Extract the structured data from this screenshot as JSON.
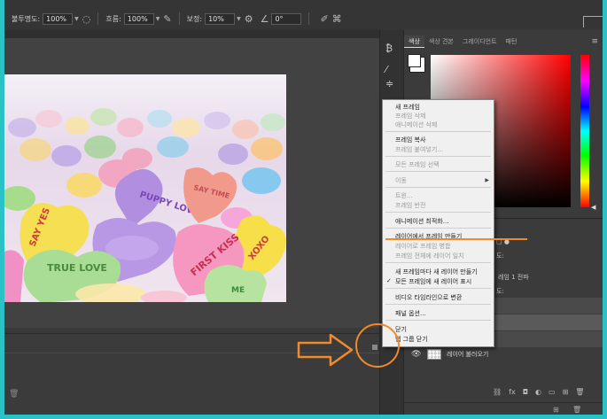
{
  "options_bar": {
    "opacity_label": "불투명도:",
    "opacity_value": "100%",
    "flow_label": "흐름:",
    "flow_value": "100%",
    "smoothing_label": "보정:",
    "smoothing_value": "10%",
    "angle_value": "0°"
  },
  "photo": {
    "hearts": [
      {
        "text": "SAY YES"
      },
      {
        "text": "TRUE LOVE"
      },
      {
        "text": "PUPPY LOVE"
      },
      {
        "text": "SAY TIME"
      },
      {
        "text": "FIRST KISS"
      },
      {
        "text": "XOXO"
      },
      {
        "text": "ME"
      }
    ]
  },
  "color_panel": {
    "tabs": [
      {
        "label": "색상"
      },
      {
        "label": "색상 견본"
      },
      {
        "label": "그레이디언트"
      },
      {
        "label": "패턴"
      }
    ]
  },
  "layers_fragments": {
    "frag_a": "도:",
    "frag_b": "레임 1 전파",
    "frag_c": "도:"
  },
  "layers": {
    "last_layer_name": "레이어 불러오기"
  },
  "context_menu": {
    "items": [
      {
        "label": "새 프레임",
        "disabled": false
      },
      {
        "label": "프레임 삭제",
        "disabled": true
      },
      {
        "label": "애니메이션 삭제",
        "disabled": true
      },
      {
        "label": "프레임 복사",
        "disabled": false
      },
      {
        "label": "프레임 붙여넣기...",
        "disabled": true
      },
      {
        "label": "모든 프레임 선택",
        "disabled": true
      },
      {
        "label": "이동",
        "disabled": true,
        "submenu": true
      },
      {
        "label": "트윈...",
        "disabled": true
      },
      {
        "label": "프레임 반전",
        "disabled": true
      },
      {
        "label": "애니메이션 최적화...",
        "disabled": false
      },
      {
        "label": "레이어에서 프레임 만들기",
        "disabled": false
      },
      {
        "label": "레이어로 프레임 병합",
        "disabled": true
      },
      {
        "label": "프레임 전체에 레이어 일치",
        "disabled": true
      },
      {
        "label": "새 프레임마다 새 레이어 만들기",
        "disabled": false
      },
      {
        "label": "모든 프레임에 새 레이어 표시",
        "disabled": false,
        "checked": true
      },
      {
        "label": "비디오 타임라인으로 변환",
        "disabled": false
      },
      {
        "label": "패널 옵션...",
        "disabled": false
      },
      {
        "label": "닫기",
        "disabled": false
      },
      {
        "label": "탭 그룹 닫기",
        "disabled": false
      }
    ]
  },
  "colors": {
    "annotation_orange": "#f08a2a",
    "frame_teal": "#29c3c7"
  }
}
